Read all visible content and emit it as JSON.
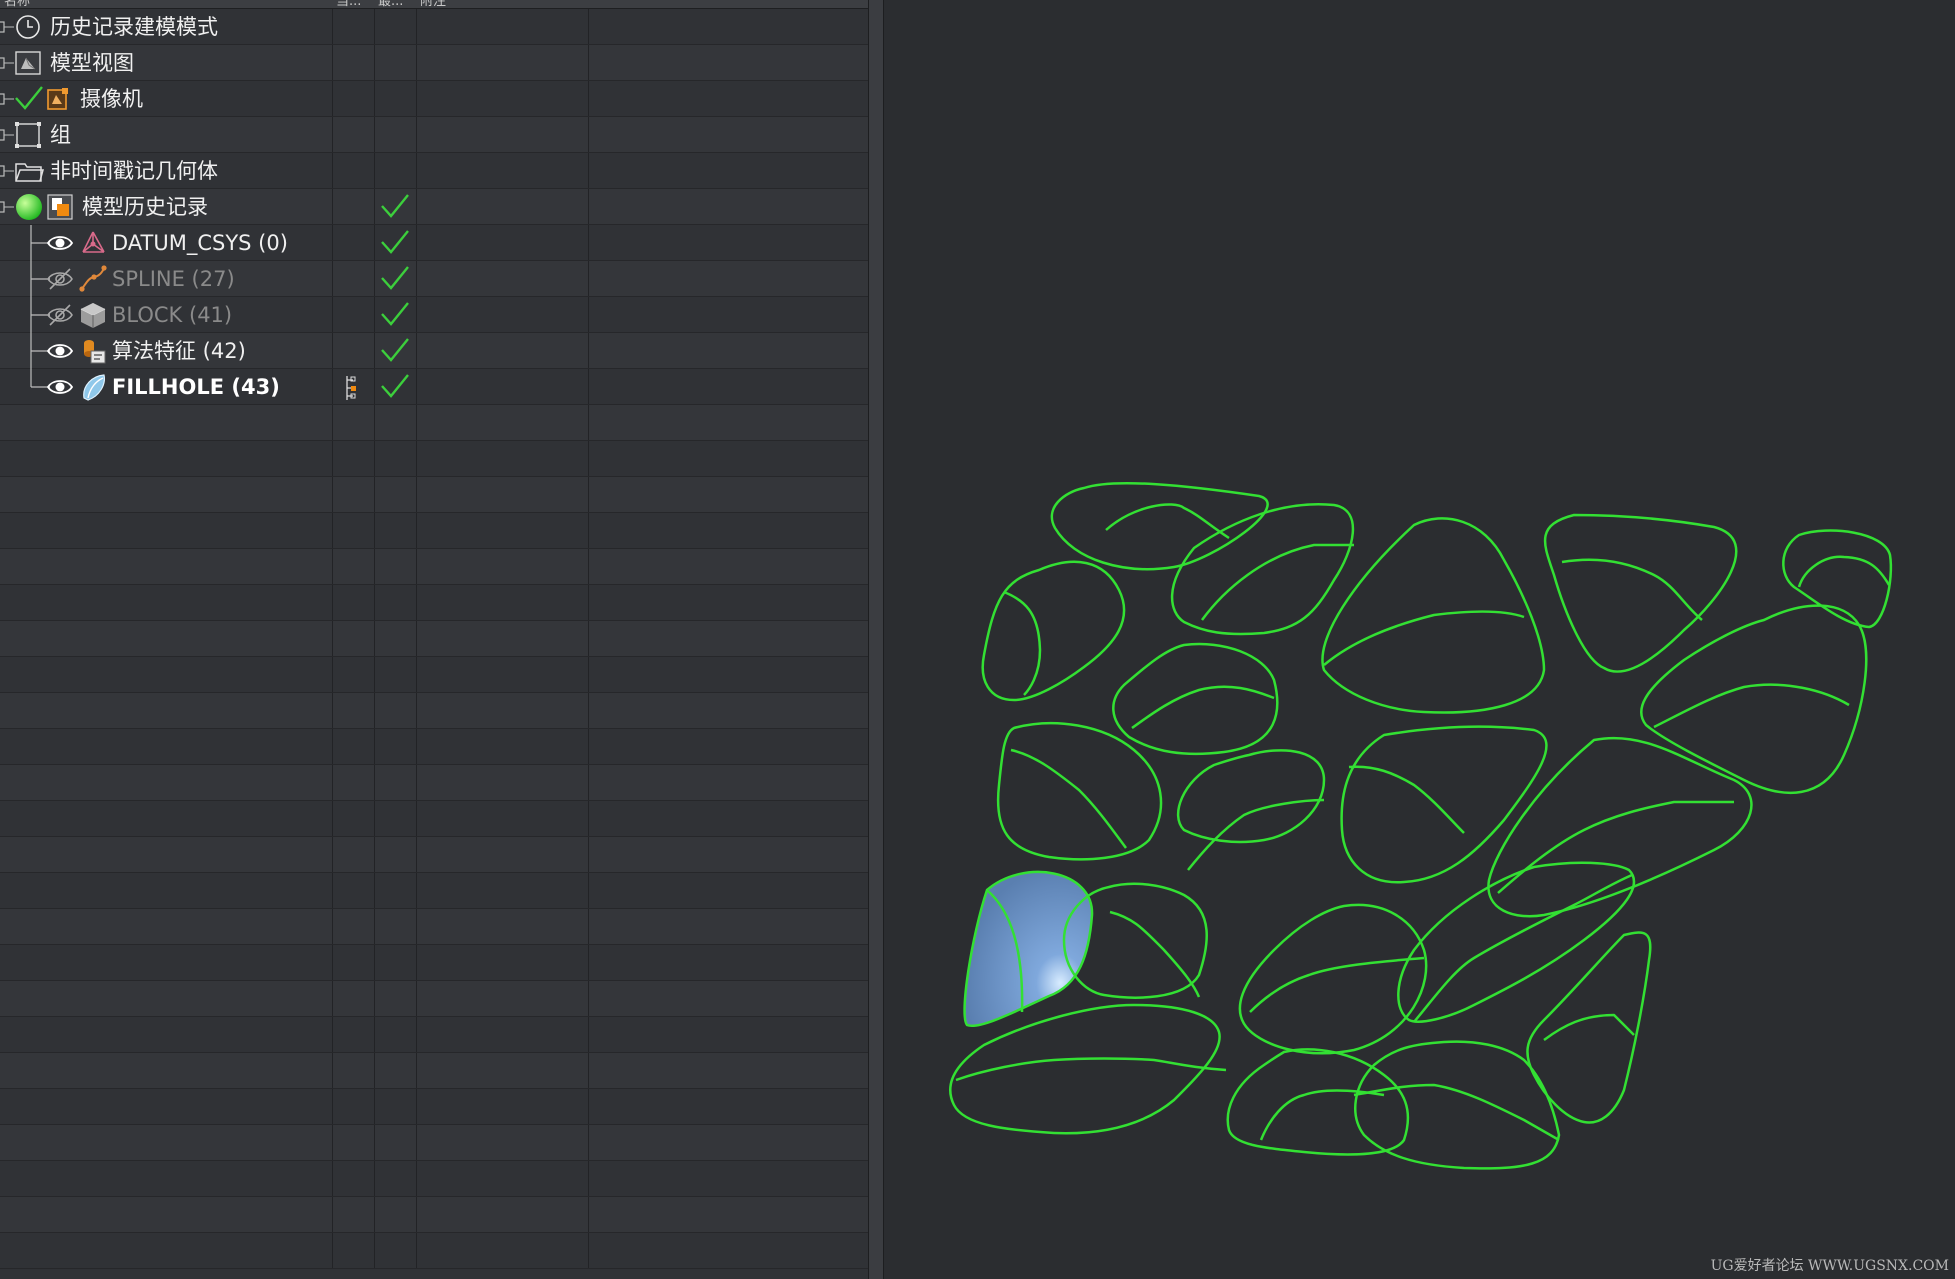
{
  "header": {
    "col_name": "名称",
    "col_2": "当...",
    "col_3": "最...",
    "col_4": "附注"
  },
  "tree": [
    {
      "label": "历史记录建模模式",
      "icon": "clock-icon",
      "style": "normal"
    },
    {
      "label": "模型视图",
      "icon": "model-view-icon",
      "style": "normal"
    },
    {
      "label": "摄像机",
      "icon": "camera-icon",
      "style": "normal",
      "checked_prefix": true
    },
    {
      "label": "组",
      "icon": "group-icon",
      "style": "normal"
    },
    {
      "label": "非时间戳记几何体",
      "icon": "folder-icon",
      "style": "normal"
    },
    {
      "label": "模型历史记录",
      "icon": "model-history-icon",
      "style": "normal",
      "status_ok": true
    },
    {
      "label": "DATUM_CSYS (0)",
      "icon": "datum-csys-icon",
      "visible": true,
      "style": "normal",
      "status_ok": true
    },
    {
      "label": "SPLINE (27)",
      "icon": "spline-icon",
      "visible": false,
      "style": "dim",
      "status_ok": true
    },
    {
      "label": "BLOCK (41)",
      "icon": "block-icon",
      "visible": false,
      "style": "dim",
      "status_ok": true
    },
    {
      "label": "算法特征 (42)",
      "icon": "algorithm-feature-icon",
      "visible": true,
      "style": "normal",
      "status_ok": true
    },
    {
      "label": "FILLHOLE (43)",
      "icon": "fillhole-icon",
      "visible": true,
      "style": "bold",
      "status_ok": true,
      "current": true
    }
  ],
  "colors": {
    "curve_green": "#33e033",
    "check_green": "#3ccf3c",
    "fill_blue": "#6f93c4"
  },
  "watermark": "UG爱好者论坛 WWW.UGSNX.COM"
}
